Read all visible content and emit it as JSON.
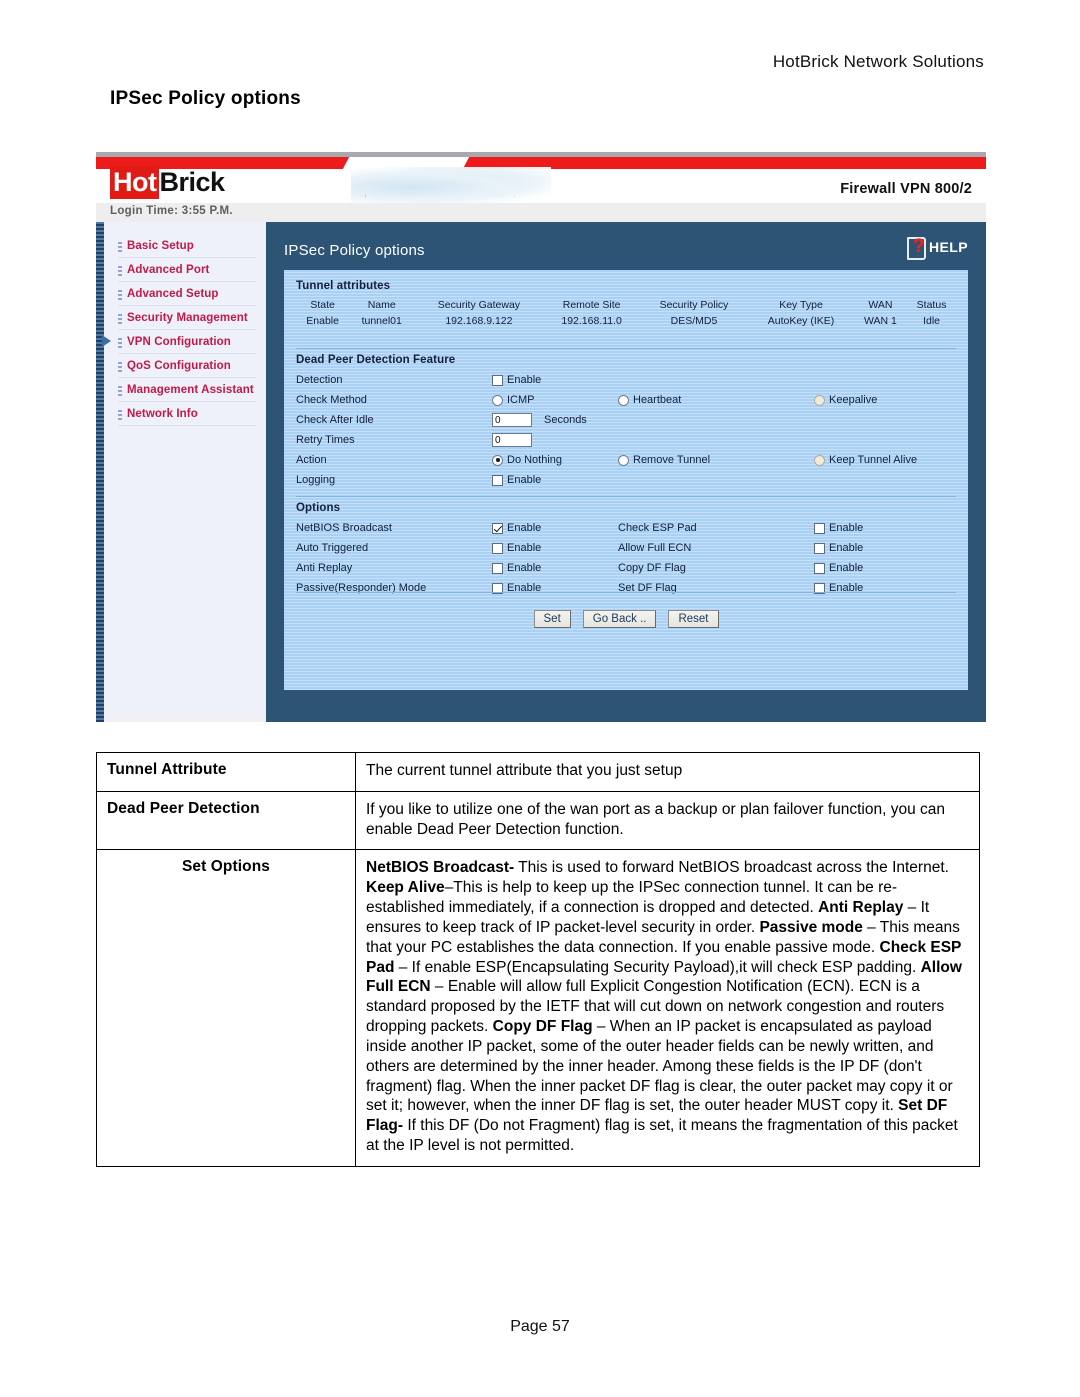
{
  "document": {
    "header_right": "HotBrick Network Solutions",
    "title": "IPSec Policy options",
    "page_label": "Page 57"
  },
  "router_ui": {
    "brand": {
      "logo_part1": "Hot",
      "logo_part2": "Brick",
      "model": "Firewall VPN 800/2"
    },
    "login_time": "Login Time: 3:55 P.M.",
    "content_title": "IPSec Policy options",
    "help_label": "HELP",
    "sidebar": {
      "items": [
        {
          "label": "Basic Setup",
          "active": false
        },
        {
          "label": "Advanced Port",
          "active": false
        },
        {
          "label": "Advanced Setup",
          "active": false
        },
        {
          "label": "Security Management",
          "active": false
        },
        {
          "label": "VPN Configuration",
          "active": true
        },
        {
          "label": "QoS Configuration",
          "active": false
        },
        {
          "label": "Management Assistant",
          "active": false
        },
        {
          "label": "Network Info",
          "active": false
        }
      ]
    },
    "tunnel_attributes": {
      "section_title": "Tunnel attributes",
      "columns": [
        "State",
        "Name",
        "Security Gateway",
        "Remote Site",
        "Security Policy",
        "Key Type",
        "WAN",
        "Status"
      ],
      "rows": [
        [
          "Enable",
          "tunnel01",
          "192.168.9.122",
          "192.168.11.0",
          "DES/MD5",
          "AutoKey (IKE)",
          "WAN 1",
          "Idle"
        ]
      ]
    },
    "dead_peer_detection": {
      "section_title": "Dead Peer Detection Feature",
      "detection_label": "Detection",
      "detection_enable_label": "Enable",
      "detection_checked": false,
      "check_method_label": "Check Method",
      "check_method_options": [
        {
          "label": "ICMP",
          "selected": false
        },
        {
          "label": "Heartbeat",
          "selected": false
        },
        {
          "label": "Keepalive",
          "selected": false
        }
      ],
      "check_after_idle_label": "Check After Idle",
      "check_after_idle_value": "0",
      "check_after_idle_unit": "Seconds",
      "retry_times_label": "Retry Times",
      "retry_times_value": "0",
      "action_label": "Action",
      "action_options": [
        {
          "label": "Do Nothing",
          "selected": true
        },
        {
          "label": "Remove Tunnel",
          "selected": false
        },
        {
          "label": "Keep Tunnel Alive",
          "selected": false
        }
      ],
      "logging_label": "Logging",
      "logging_enable_label": "Enable",
      "logging_checked": false
    },
    "options": {
      "section_title": "Options",
      "enable_label": "Enable",
      "left_rows": [
        {
          "label": "NetBIOS Broadcast",
          "checked": true
        },
        {
          "label": "Auto Triggered",
          "checked": false
        },
        {
          "label": "Anti Replay",
          "checked": false
        },
        {
          "label": "Passive(Responder) Mode",
          "checked": false
        }
      ],
      "right_rows": [
        {
          "label": "Check ESP Pad",
          "checked": false
        },
        {
          "label": "Allow Full ECN",
          "checked": false
        },
        {
          "label": "Copy DF Flag",
          "checked": false
        },
        {
          "label": "Set DF Flag",
          "checked": false
        }
      ]
    },
    "buttons": [
      {
        "label": "Set"
      },
      {
        "label": "Go Back .."
      },
      {
        "label": "Reset"
      }
    ]
  },
  "description_table": {
    "rows": [
      {
        "key": "Tunnel Attribute",
        "key_centered": false,
        "value_html": "The current tunnel attribute that you just setup"
      },
      {
        "key": "Dead Peer Detection",
        "key_centered": false,
        "value_html": "If you like to utilize one of the wan port as a backup or plan failover function, you can enable Dead Peer Detection function."
      },
      {
        "key": "Set Options",
        "key_centered": true,
        "value_html": "<b>NetBIOS Broadcast-</b> This is used to forward NetBIOS broadcast across the Internet. <b>Keep Alive</b>&ndash;This is help to keep up the IPSec connection tunnel. It can be re-established immediately, if a connection is dropped and detected. <b>Anti Replay</b> &ndash; It ensures to keep track of IP packet-level security in order. <b>Passive mode</b> &ndash; This means that your PC establishes the data connection. If you enable passive mode. <b>Check ESP Pad</b> &ndash; If enable ESP(Encapsulating Security Payload),it will check ESP padding. <b>Allow Full ECN</b> &ndash; Enable will allow full Explicit Congestion Notification (ECN). ECN is a standard proposed by the IETF that will cut down on network congestion and routers dropping packets. <b>Copy DF Flag</b> &ndash; When an IP packet is encapsulated as payload inside another IP packet, some of the outer header fields can be newly written, and others are determined by the inner header. Among these fields is the IP DF (don't fragment) flag. When the inner packet DF flag is clear, the outer packet may copy it or set it; however, when the inner DF flag is set, the outer header MUST copy it. <b>Set DF Flag-</b> If this DF (Do not Fragment) flag is set, it means the fragmentation of this packet at the IP level is not permitted."
      }
    ]
  },
  "colors": {
    "brand_red": "#e01b16",
    "panel_blue": "#a9d0f5",
    "content_blue": "#2d5375",
    "nav_text": "#c21a48"
  }
}
